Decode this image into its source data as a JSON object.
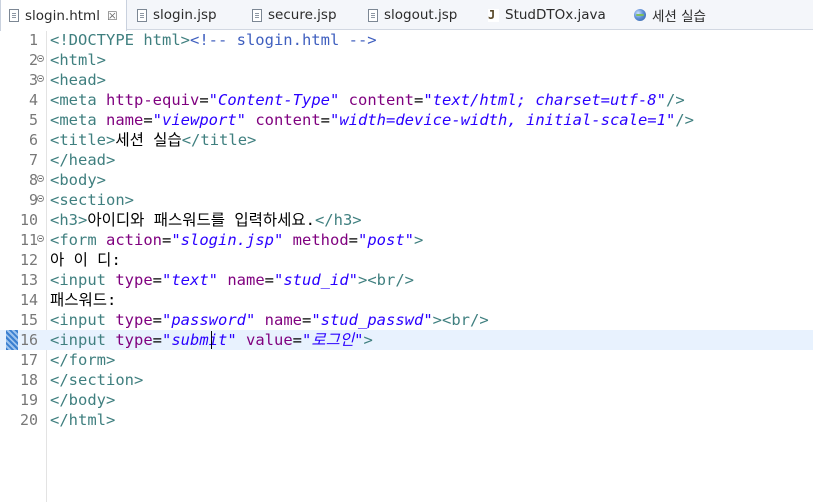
{
  "tabs": [
    {
      "label": "slogin.html",
      "icon": "html-file-icon",
      "active": true,
      "close": "☒"
    },
    {
      "label": "slogin.jsp",
      "icon": "jsp-file-icon",
      "active": false
    },
    {
      "label": "secure.jsp",
      "icon": "jsp-file-icon",
      "active": false
    },
    {
      "label": "slogout.jsp",
      "icon": "jsp-file-icon",
      "active": false
    },
    {
      "label": "StudDTOx.java",
      "icon": "java-file-icon",
      "active": false,
      "glyph": "J"
    },
    {
      "label": "세션 실습",
      "icon": "web-browser-icon",
      "active": false
    }
  ],
  "editor": {
    "current_line": 16,
    "lines": [
      {
        "n": "1",
        "fold": false,
        "seg": [
          [
            "tag",
            "<!DOCTYPE html>"
          ],
          [
            "cmt",
            "<!-- slogin.html -->"
          ]
        ]
      },
      {
        "n": "2",
        "fold": true,
        "seg": [
          [
            "tag",
            "<html>"
          ]
        ]
      },
      {
        "n": "3",
        "fold": true,
        "seg": [
          [
            "tag",
            "<head>"
          ]
        ]
      },
      {
        "n": "4",
        "fold": false,
        "seg": [
          [
            "tag",
            "<meta "
          ],
          [
            "attr",
            "http-equiv"
          ],
          [
            "txt",
            "="
          ],
          [
            "val",
            "\"Content-Type\""
          ],
          [
            "txt",
            " "
          ],
          [
            "attr",
            "content"
          ],
          [
            "txt",
            "="
          ],
          [
            "val",
            "\"text/html; charset=utf-8\""
          ],
          [
            "tag",
            "/>"
          ]
        ]
      },
      {
        "n": "5",
        "fold": false,
        "seg": [
          [
            "tag",
            "<meta "
          ],
          [
            "attr",
            "name"
          ],
          [
            "txt",
            "="
          ],
          [
            "val",
            "\"viewport\""
          ],
          [
            "txt",
            " "
          ],
          [
            "attr",
            "content"
          ],
          [
            "txt",
            "="
          ],
          [
            "val",
            "\"width=device-width, initial-scale=1\""
          ],
          [
            "tag",
            "/>"
          ]
        ]
      },
      {
        "n": "6",
        "fold": false,
        "seg": [
          [
            "tag",
            "<title>"
          ],
          [
            "txt",
            "세션 실습"
          ],
          [
            "tag",
            "</title>"
          ]
        ]
      },
      {
        "n": "7",
        "fold": false,
        "seg": [
          [
            "tag",
            "</head>"
          ]
        ]
      },
      {
        "n": "8",
        "fold": true,
        "seg": [
          [
            "tag",
            "<body>"
          ]
        ]
      },
      {
        "n": "9",
        "fold": true,
        "seg": [
          [
            "tag",
            "<section>"
          ]
        ]
      },
      {
        "n": "10",
        "fold": false,
        "seg": [
          [
            "tag",
            "<h3>"
          ],
          [
            "txt",
            "아이디와 패스워드를 입력하세요."
          ],
          [
            "tag",
            "</h3>"
          ]
        ]
      },
      {
        "n": "11",
        "fold": true,
        "seg": [
          [
            "tag",
            "<form "
          ],
          [
            "attr",
            "action"
          ],
          [
            "txt",
            "="
          ],
          [
            "val",
            "\"slogin.jsp\""
          ],
          [
            "txt",
            " "
          ],
          [
            "attr",
            "method"
          ],
          [
            "txt",
            "="
          ],
          [
            "val",
            "\"post\""
          ],
          [
            "tag",
            ">"
          ]
        ]
      },
      {
        "n": "12",
        "fold": false,
        "seg": [
          [
            "txt",
            "아 이 디:"
          ]
        ]
      },
      {
        "n": "13",
        "fold": false,
        "seg": [
          [
            "tag",
            "<input "
          ],
          [
            "attr",
            "type"
          ],
          [
            "txt",
            "="
          ],
          [
            "val",
            "\"text\""
          ],
          [
            "txt",
            " "
          ],
          [
            "attr",
            "name"
          ],
          [
            "txt",
            "="
          ],
          [
            "val",
            "\"stud_id\""
          ],
          [
            "tag",
            "><br/>"
          ]
        ]
      },
      {
        "n": "14",
        "fold": false,
        "seg": [
          [
            "txt",
            "패스워드:"
          ]
        ]
      },
      {
        "n": "15",
        "fold": false,
        "seg": [
          [
            "tag",
            "<input "
          ],
          [
            "attr",
            "type"
          ],
          [
            "txt",
            "="
          ],
          [
            "val",
            "\"password\""
          ],
          [
            "txt",
            " "
          ],
          [
            "attr",
            "name"
          ],
          [
            "txt",
            "="
          ],
          [
            "val",
            "\"stud_passwd\""
          ],
          [
            "tag",
            "><br/>"
          ]
        ]
      },
      {
        "n": "16",
        "fold": false,
        "seg": [
          [
            "tag",
            "<input "
          ],
          [
            "attr",
            "type"
          ],
          [
            "txt",
            "="
          ],
          [
            "val",
            "\"submit\""
          ],
          [
            "txt",
            " "
          ],
          [
            "attr",
            "value"
          ],
          [
            "txt",
            "="
          ],
          [
            "val",
            "\"로그인\""
          ],
          [
            "tag",
            ">"
          ]
        ]
      },
      {
        "n": "17",
        "fold": false,
        "seg": [
          [
            "tag",
            "</form>"
          ]
        ]
      },
      {
        "n": "18",
        "fold": false,
        "seg": [
          [
            "tag",
            "</section>"
          ]
        ]
      },
      {
        "n": "19",
        "fold": false,
        "seg": [
          [
            "tag",
            "</body>"
          ]
        ]
      },
      {
        "n": "20",
        "fold": false,
        "seg": [
          [
            "tag",
            "</html>"
          ]
        ]
      }
    ]
  },
  "colors": {
    "tag": "#3f7f7f",
    "attribute": "#7f007f",
    "value": "#2a00ff",
    "comment": "#3f5fbf",
    "current_line": "#e8f2fe"
  }
}
